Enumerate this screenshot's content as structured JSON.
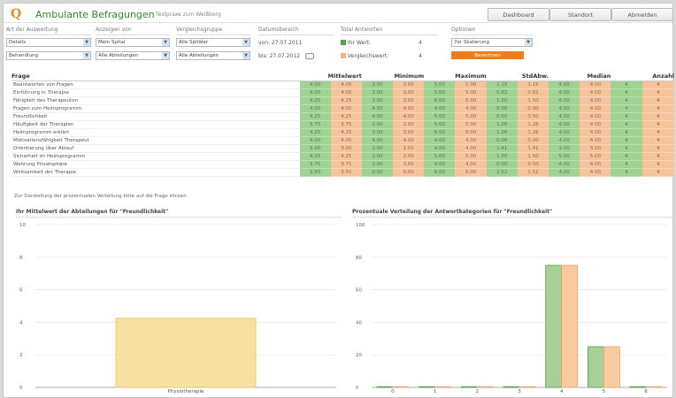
{
  "app": {
    "logo": "Q",
    "title": "Ambulante Befragungen",
    "subtitle": "Testpraxe zum Weißberg"
  },
  "nav": {
    "dashboard": "Dashboard",
    "standort": "Standort",
    "abmelden": "Abmelden"
  },
  "filters": {
    "art": {
      "label": "Art der Auswertung",
      "v1": "Details",
      "v2": "Behandlung"
    },
    "anzeigen": {
      "label": "Anzeigen von",
      "v1": "Mein Spital",
      "v2": "Alle Abteilungen"
    },
    "vergleich": {
      "label": "Vergleichsgruppe",
      "v1": "Alle Spitäler",
      "v2": "Alle Abteilungen"
    },
    "datum": {
      "label": "Datumsbereich",
      "von": "von: 27.07.2011",
      "bis": "bis: 27.07.2012"
    },
    "total": {
      "label": "Total Antworten",
      "ihr_label": "Ihr Wert:",
      "ihr_value": "4",
      "vgl_label": "Vergleichswert:",
      "vgl_value": "4"
    },
    "optionen": {
      "label": "Optionen",
      "skala": "7er Skalierung",
      "button": "Berechnen"
    }
  },
  "colors": {
    "green": "#9ed391",
    "orange": "#f6c39a",
    "accent": "#f07d1a",
    "bar_yellow": "#f7e0a0"
  },
  "table": {
    "headers": [
      "Frage",
      "Mittelwert",
      "Minimum",
      "Maximum",
      "StdAbw.",
      "Median",
      "Anzahl"
    ],
    "rows": [
      {
        "q": "Beantworten von Fragen",
        "v": [
          "4.00",
          "4.00",
          "3.00",
          "3.00",
          "5.00",
          "5.00",
          "1.15",
          "1.15",
          "4.00",
          "4.00",
          "4",
          "4"
        ]
      },
      {
        "q": "Einführung in Therapie",
        "v": [
          "4.00",
          "4.00",
          "3.00",
          "3.00",
          "5.00",
          "5.00",
          "0.82",
          "0.82",
          "4.00",
          "4.00",
          "4",
          "4"
        ]
      },
      {
        "q": "Fähigkeit des Therapeuten",
        "v": [
          "4.25",
          "4.25",
          "3.00",
          "3.00",
          "6.00",
          "6.00",
          "1.50",
          "1.50",
          "4.00",
          "4.00",
          "4",
          "4"
        ]
      },
      {
        "q": "Fragen zum Heimprogramm",
        "v": [
          "4.00",
          "4.00",
          "4.00",
          "4.00",
          "4.00",
          "4.00",
          "0.00",
          "0.00",
          "4.00",
          "4.00",
          "4",
          "4"
        ]
      },
      {
        "q": "Freundlichkeit",
        "v": [
          "4.25",
          "4.25",
          "4.00",
          "4.00",
          "5.00",
          "5.00",
          "0.50",
          "0.50",
          "4.00",
          "4.00",
          "4",
          "4"
        ]
      },
      {
        "q": "Häufigkeit der Therapien",
        "v": [
          "3.75",
          "3.75",
          "2.00",
          "2.00",
          "5.00",
          "5.00",
          "1.26",
          "1.26",
          "4.00",
          "4.00",
          "4",
          "4"
        ]
      },
      {
        "q": "Heimprogramm erklärt",
        "v": [
          "4.25",
          "4.25",
          "3.00",
          "3.00",
          "6.00",
          "6.00",
          "1.26",
          "1.26",
          "4.00",
          "4.00",
          "4",
          "4"
        ]
      },
      {
        "q": "Motivationsfähigkeit Therapeut",
        "v": [
          "4.00",
          "4.00",
          "4.00",
          "4.00",
          "4.00",
          "4.00",
          "0.00",
          "0.00",
          "4.00",
          "4.00",
          "4",
          "4"
        ]
      },
      {
        "q": "Orientierung über Ablauf",
        "v": [
          "3.00",
          "3.00",
          "1.00",
          "1.00",
          "4.00",
          "4.00",
          "1.41",
          "1.41",
          "3.00",
          "3.00",
          "4",
          "4"
        ]
      },
      {
        "q": "Sicherheit im Heimprogramm",
        "v": [
          "4.25",
          "4.25",
          "2.00",
          "2.00",
          "5.00",
          "5.00",
          "1.50",
          "1.50",
          "5.00",
          "5.00",
          "4",
          "4"
        ]
      },
      {
        "q": "Wahrung Privatsphäre",
        "v": [
          "3.75",
          "3.75",
          "3.00",
          "3.00",
          "4.00",
          "4.00",
          "0.50",
          "0.50",
          "4.00",
          "4.00",
          "4",
          "4"
        ]
      },
      {
        "q": "Wirksamkeit der Therapie",
        "v": [
          "3.50",
          "3.50",
          "0.00",
          "0.00",
          "6.00",
          "6.00",
          "2.52",
          "2.52",
          "4.00",
          "4.00",
          "4",
          "4"
        ]
      }
    ]
  },
  "hint": "Zur Darstellung der prozentualen Verteilung bitte auf die Frage klicken",
  "chart_data": [
    {
      "type": "bar",
      "title": "Ihr Mittelwert der Abteilungen für \"Freundlichkeit\"",
      "categories": [
        "Physiotherapie"
      ],
      "values": [
        4.25
      ],
      "ylim": [
        0,
        10
      ],
      "yticks": [
        "0",
        "2",
        "4",
        "6",
        "8",
        "10"
      ],
      "grid": true
    },
    {
      "type": "bar",
      "title": "Prozentuale Verteilung der Antwortkategorien für \"Freundlichkeit\"",
      "categories": [
        "0",
        "1",
        "2",
        "3",
        "4",
        "5",
        "6"
      ],
      "series": [
        {
          "color": "#a8cf98",
          "values": [
            0,
            0,
            0,
            0,
            75,
            25,
            0
          ]
        },
        {
          "color": "#f9c99f",
          "values": [
            0,
            0,
            0,
            0,
            75,
            25,
            0
          ]
        }
      ],
      "ylim": [
        0,
        100
      ],
      "yticks": [
        "0",
        "20",
        "40",
        "60",
        "80",
        "100"
      ],
      "grid": true
    }
  ]
}
